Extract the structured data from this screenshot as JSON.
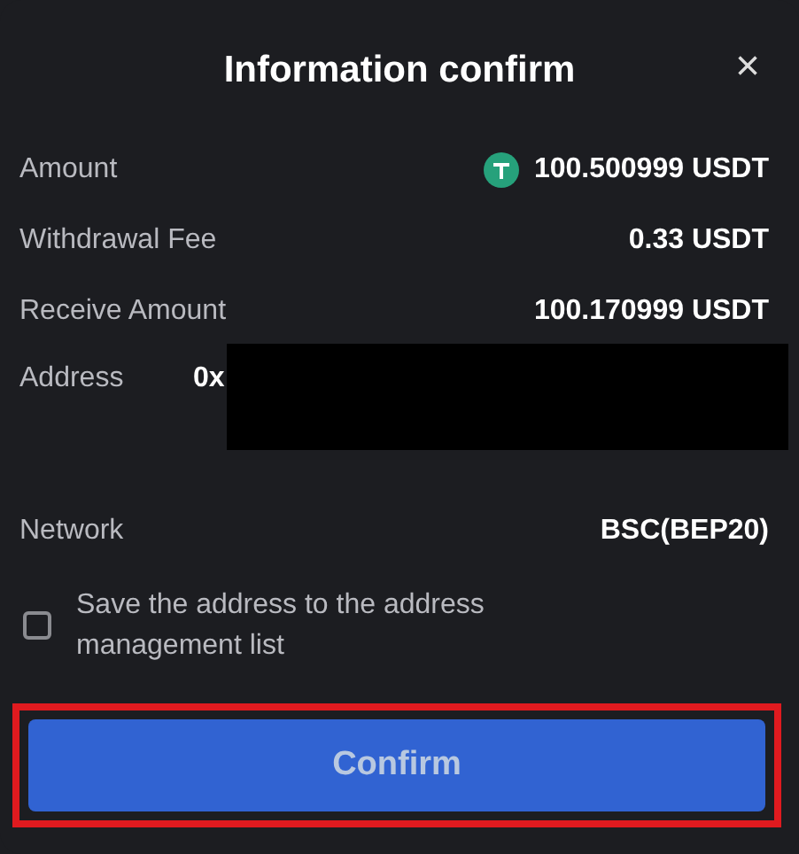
{
  "dialog": {
    "title": "Information confirm",
    "close": "×"
  },
  "rows": [
    {
      "kind": "token",
      "label": "Amount",
      "value": "100.500999 USDT"
    },
    {
      "kind": "plain",
      "label": "Withdrawal Fee",
      "value": "0.33 USDT"
    },
    {
      "kind": "plain",
      "label": "Receive Amount",
      "value": "100.170999 USDT"
    },
    {
      "kind": "redacted",
      "label": "Address",
      "value": "0x"
    },
    {
      "kind": "plain",
      "label": "Network",
      "value": "BSC(BEP20)"
    }
  ],
  "save_option": {
    "label": "Save the address to the address management list",
    "checked": false
  },
  "confirm_button": {
    "label": "Confirm",
    "highlighted": true
  }
}
